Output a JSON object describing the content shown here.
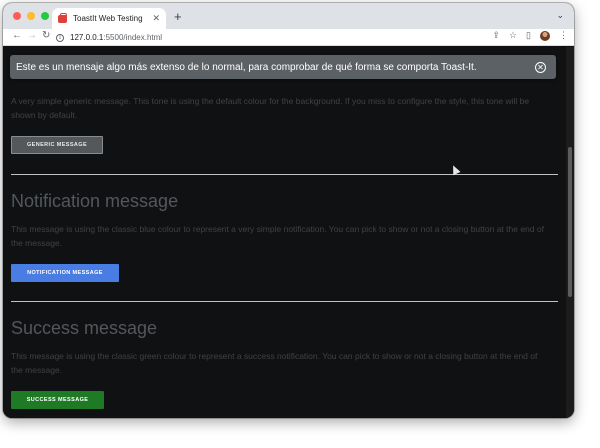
{
  "browser": {
    "tab": {
      "title": "ToastIt Web Testing",
      "close": "✕"
    },
    "new_tab": "+",
    "menu": "⌄",
    "nav": {
      "back": "←",
      "forward": "→",
      "reload": "↻"
    },
    "url": {
      "host": "127.0.0.1",
      "rest": ":5500/index.html",
      "info": "i"
    },
    "toolbar_icons": {
      "share": "⇪",
      "bookmark": "☆",
      "sidebar": "▯",
      "more": "⋮"
    }
  },
  "toast": {
    "message": "Este es un mensaje algo más extenso de lo normal, para comprobar de qué forma se comporta Toast-It.",
    "close": "✕"
  },
  "page": {
    "generic": {
      "description": "A very simple generic message. This tone is using the default colour for the background. If you miss to configure the style, this tone will be shown by default.",
      "button": "GENERIC MESSAGE"
    },
    "notification": {
      "title": "Notification message",
      "description": "This message is using the classic blue colour to represent a very simple notification. You can pick to show or not a closing button at the end of the message.",
      "button": "NOTIFICATION MESSAGE"
    },
    "success": {
      "title": "Success message",
      "description": "This message is using the classic green colour to represent a success notification. You can pick to show or not a closing button at the end of the message.",
      "button": "SUCCESS MESSAGE"
    }
  },
  "colors": {
    "generic": "#55585b",
    "notification": "#4a7de3",
    "success": "#1f7a26",
    "toast": "#5c6166"
  }
}
